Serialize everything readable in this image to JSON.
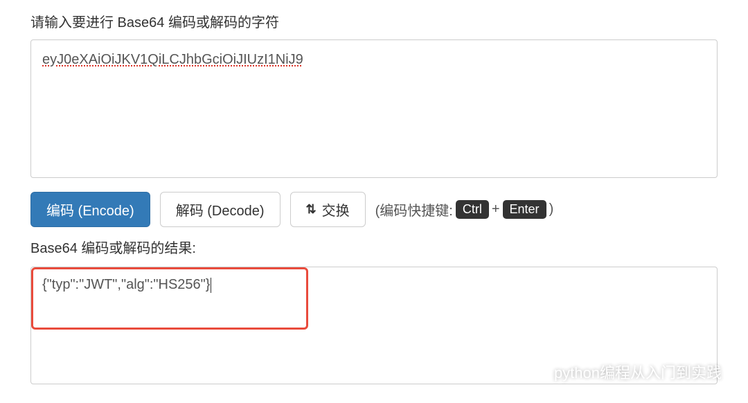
{
  "input": {
    "label": "请输入要进行 Base64 编码或解码的字符",
    "value": "eyJ0eXAiOiJKV1QiLCJhbGciOiJIUzI1NiJ9"
  },
  "buttons": {
    "encode": "编码 (Encode)",
    "decode": "解码 (Decode)",
    "swap": "交换"
  },
  "shortcut": {
    "prefix": "(编码快捷键: ",
    "key1": "Ctrl",
    "plus": "+",
    "key2": "Enter",
    "suffix": ")"
  },
  "output": {
    "label": "Base64 编码或解码的结果:",
    "value": "{\"typ\":\"JWT\",\"alg\":\"HS256\"}"
  },
  "watermark": {
    "text": "python编程从入门到实践"
  }
}
